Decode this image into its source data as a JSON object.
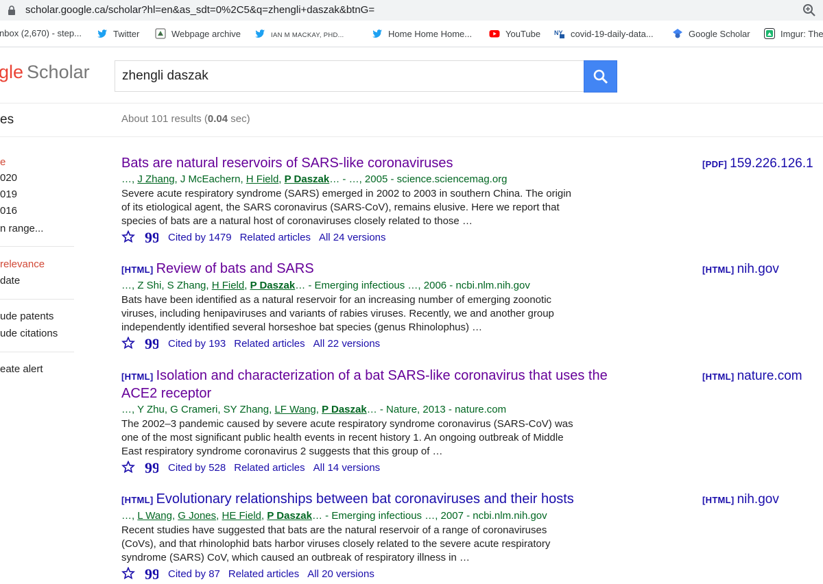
{
  "browser": {
    "url": "scholar.google.ca/scholar?hl=en&as_sdt=0%2C5&q=zhengli+daszak&btnG=",
    "bookmarks": [
      {
        "label": "nbox (2,670) - step...",
        "icon": "gmail-icon"
      },
      {
        "label": "Twitter",
        "icon": "twitter-icon"
      },
      {
        "label": "Webpage archive",
        "icon": "archive-icon"
      },
      {
        "label": "IAN M MACKAY, PHD...",
        "icon": "twitter-icon"
      },
      {
        "label": "Home Home Home...",
        "icon": "twitter-icon"
      },
      {
        "label": "YouTube",
        "icon": "youtube-icon"
      },
      {
        "label": "covid-19-daily-data...",
        "icon": "nyc-icon"
      },
      {
        "label": "Google Scholar",
        "icon": "scholar-icon"
      },
      {
        "label": "Imgur: The",
        "icon": "imgur-icon"
      }
    ]
  },
  "logo": {
    "part1": "g",
    "part2": "le",
    "part3": "Scholar"
  },
  "search": {
    "query": "zhengli daszak"
  },
  "articles_label": "es",
  "results_count": {
    "prefix": "About 101 results (",
    "time": "0.04",
    "suffix": " sec)"
  },
  "sidebar": {
    "time_items": [
      "e",
      "020",
      "019",
      "016",
      "n range..."
    ],
    "sort_items": [
      "relevance",
      "date"
    ],
    "include_items": [
      "ude patents",
      "ude citations"
    ],
    "alert": "eate alert"
  },
  "results": [
    {
      "tag": "",
      "title": "Bats are natural reservoirs of SARS-like coronaviruses",
      "meta_prefix": "…, ",
      "authors": [
        "J Zhang",
        "J McEachern",
        "H Field",
        "P Daszak"
      ],
      "meta_suffix": "… - …, 2005 - science.sciencemag.org",
      "snippet": "Severe acute respiratory syndrome (SARS) emerged in 2002 to 2003 in southern China. The origin of its etiological agent, the SARS coronavirus (SARS-CoV), remains elusive. Here we report that species of bats are a natural host of coronaviruses closely related to those …",
      "cited_by": "Cited by 1479",
      "related": "Related articles",
      "versions": "All 24 versions",
      "side_tag": "[PDF]",
      "side_link": "159.226.126.1"
    },
    {
      "tag": "[HTML]",
      "title": "Review of bats and SARS",
      "meta_prefix": "…, Z Shi, S Zhang, ",
      "authors": [
        "H Field",
        "P Daszak"
      ],
      "meta_suffix": "… - Emerging infectious …, 2006 - ncbi.nlm.nih.gov",
      "snippet": "Bats have been identified as a natural reservoir for an increasing number of emerging zoonotic viruses, including henipaviruses and variants of rabies viruses. Recently, we and another group independently identified several horseshoe bat species (genus Rhinolophus) …",
      "cited_by": "Cited by 193",
      "related": "Related articles",
      "versions": "All 22 versions",
      "side_tag": "[HTML]",
      "side_link": "nih.gov"
    },
    {
      "tag": "[HTML]",
      "title": "Isolation and characterization of a bat SARS-like coronavirus that uses the ACE2 receptor",
      "meta_prefix": "…, Y Zhu, G Crameri, SY Zhang, ",
      "authors": [
        "LF Wang",
        "P Daszak"
      ],
      "meta_suffix": "… - Nature, 2013 - nature.com",
      "snippet": "The 2002–3 pandemic caused by severe acute respiratory syndrome coronavirus (SARS-CoV) was one of the most significant public health events in recent history 1. An ongoing outbreak of Middle East respiratory syndrome coronavirus 2 suggests that this group of …",
      "cited_by": "Cited by 528",
      "related": "Related articles",
      "versions": "All 14 versions",
      "side_tag": "[HTML]",
      "side_link": "nature.com"
    },
    {
      "tag": "[HTML]",
      "title": "Evolutionary relationships between bat coronaviruses and their hosts",
      "meta_prefix": "…, ",
      "authors": [
        "L Wang",
        "G Jones",
        "HE Field",
        "P Daszak"
      ],
      "meta_suffix": "… - Emerging infectious …, 2007 - ncbi.nlm.nih.gov",
      "snippet": "Recent studies have suggested that bats are the natural reservoir of a range of coronaviruses (CoVs), and that rhinolophid bats harbor viruses closely related to the severe acute respiratory syndrome (SARS) CoV, which caused an outbreak of respiratory illness in …",
      "cited_by": "Cited by 87",
      "related": "Related articles",
      "versions": "All 20 versions",
      "side_tag": "[HTML]",
      "side_link": "nih.gov"
    }
  ]
}
